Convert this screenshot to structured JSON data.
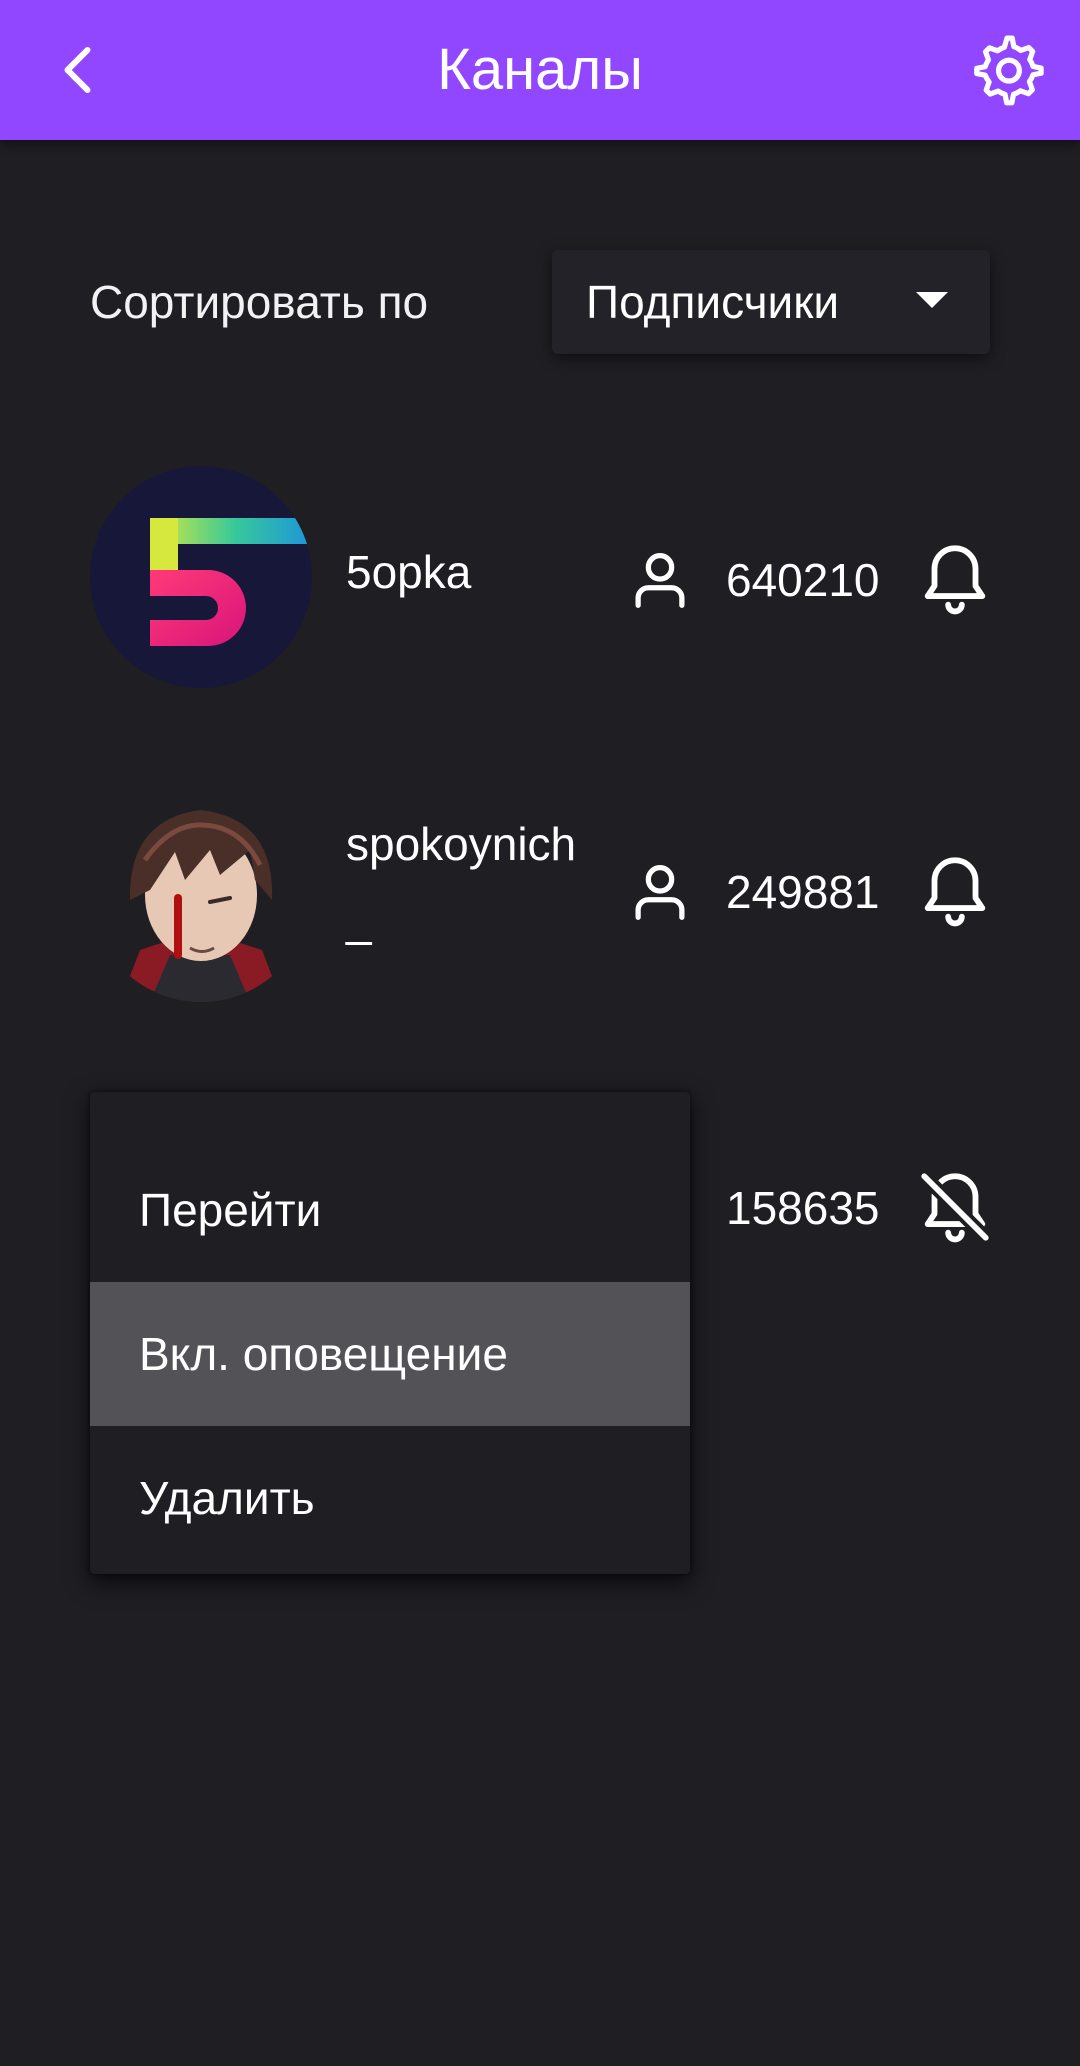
{
  "app_bar": {
    "title": "Каналы",
    "color": "#9146ff",
    "back_icon": "chevron-left-icon",
    "settings_icon": "gear-icon"
  },
  "sort": {
    "label": "Сортировать по",
    "selected": "Подписчики"
  },
  "channels": [
    {
      "name": "5opka",
      "followers": "640210",
      "notifications": "on"
    },
    {
      "name": "spokoynich\n_",
      "followers": "249881",
      "notifications": "on"
    },
    {
      "name": "",
      "followers": "158635",
      "notifications": "off"
    }
  ],
  "context_menu": {
    "items": [
      {
        "label": "Перейти"
      },
      {
        "label": "Вкл. оповещение",
        "highlighted": true
      },
      {
        "label": "Удалить"
      }
    ]
  }
}
